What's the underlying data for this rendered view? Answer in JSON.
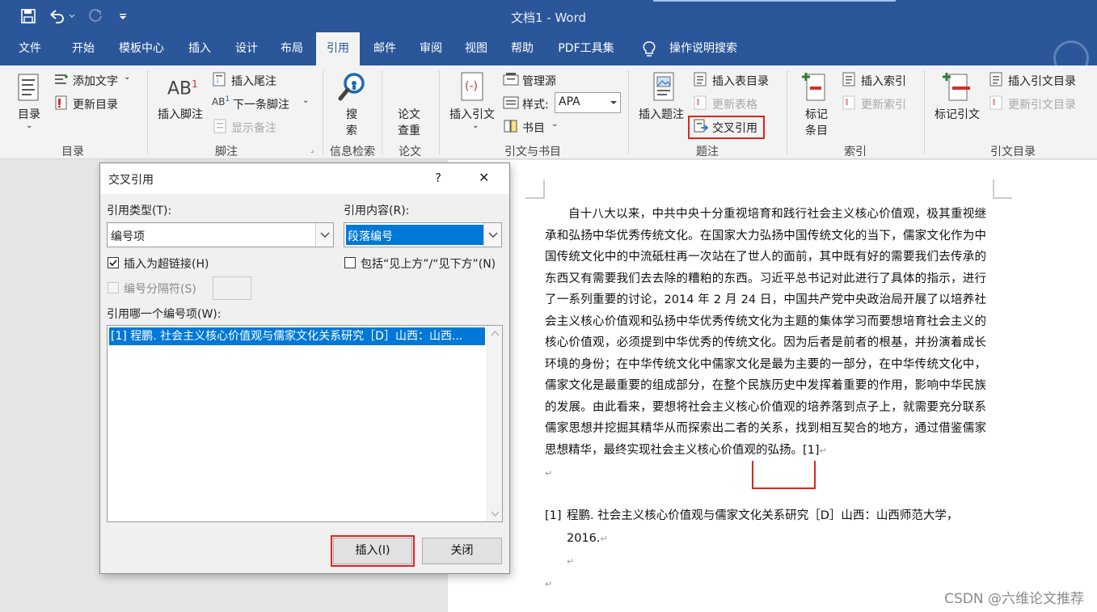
{
  "window": {
    "doc_title": "文档1  -  Word"
  },
  "tabs": [
    {
      "label": "文件"
    },
    {
      "label": "开始"
    },
    {
      "label": "模板中心"
    },
    {
      "label": "插入"
    },
    {
      "label": "设计"
    },
    {
      "label": "布局"
    },
    {
      "label": "引用"
    },
    {
      "label": "邮件"
    },
    {
      "label": "审阅"
    },
    {
      "label": "视图"
    },
    {
      "label": "帮助"
    },
    {
      "label": "PDF工具集"
    },
    {
      "label": "操作说明搜索"
    }
  ],
  "ribbon": {
    "toc": {
      "button": "目录",
      "add_text": "添加文字",
      "update_toc": "更新目录",
      "group": "目录"
    },
    "footnote": {
      "insert_footnote": "插入脚注",
      "insert_endnote": "插入尾注",
      "next_footnote": "下一条脚注",
      "show_notes": "显示备注",
      "group": "脚注"
    },
    "research": {
      "search_line1": "搜",
      "search_line2": "索",
      "group": "信息检索"
    },
    "paper": {
      "line1": "论文",
      "line2": "查重",
      "group": "论文"
    },
    "citations": {
      "insert_citation": "插入引文",
      "manage_sources": "管理源",
      "style_label": "样式:",
      "style_value": "APA",
      "bibliography": "书目",
      "group": "引文与书目"
    },
    "captions": {
      "insert_caption": "插入题注",
      "insert_table_figures": "插入表目录",
      "update_table": "更新表格",
      "cross_reference": "交叉引用",
      "group": "题注"
    },
    "index": {
      "mark_entry_line1": "标记",
      "mark_entry_line2": "条目",
      "insert_index": "插入索引",
      "update_index": "更新索引",
      "group": "索引"
    },
    "toa": {
      "mark_citation": "标记引文",
      "insert_toa": "插入引文目录",
      "update_toa": "更新引文目录",
      "group": "引文目录"
    }
  },
  "document": {
    "paragraph": "自十八大以来，中共中央十分重视培育和践行社会主义核心价值观，极其重视继承和弘扬中华优秀传统文化。在国家大力弘扬中国传统文化的当下，儒家文化作为中国传统文化中的中流砥柱再一次站在了世人的面前，其中既有好的需要我们去传承的东西又有需要我们去去除的糟粕的东西。习近平总书记对此进行了具体的指示，进行了一系列重要的讨论，2014 年 2 月 24 日，中国共产党中央政治局开展了以培养社会主义核心价值观和弘扬中华优秀传统文化为主题的集体学习而要想培育社会主义的核心价值观，必须提到中华优秀的传统文化。因为后者是前者的根基，并扮演着成长环境的身份；在中华传统文化中儒家文化是最为主要的一部分，在中华传统文化中，儒家文化是最重要的组成部分，在整个民族历史中发挥着重要的作用，影响中华民族的发展。由此看来，要想将社会主义核心价值观的培养落到点子上，就需要充分联系儒家思想并挖掘其精华从而探索出二者的关系，找到相互契合的地方，通过借鉴儒家思想精华，最终实现社会主义核心价值观的",
    "paragraph_end": "弘扬。",
    "citation_mark": "[1]",
    "ref_number": "[1]",
    "ref_text": "程鹏. 社会主义核心价值观与儒家文化关系研究［D］山西：山西师范大学，2016.",
    "para_mark": "↵"
  },
  "dialog": {
    "title": "交叉引用",
    "help": "?",
    "close": "✕",
    "ref_type_label": "引用类型(T):",
    "ref_type_value": "编号项",
    "ref_content_label": "引用内容(R):",
    "ref_content_value": "段落编号",
    "insert_hyperlink_label": "插入为超链接(H)",
    "include_above_below_label": "包括“见上方”/“见下方”(N)",
    "separator_label": "编号分隔符(S)",
    "which_item_label": "引用哪一个编号项(W):",
    "items": [
      {
        "text": "[1] 程鹏. 社会主义核心价值观与儒家文化关系研究［D］山西：山西..."
      }
    ],
    "insert_button": "插入(I)",
    "close_button": "关闭"
  },
  "watermark": "CSDN @六维论文推荐"
}
